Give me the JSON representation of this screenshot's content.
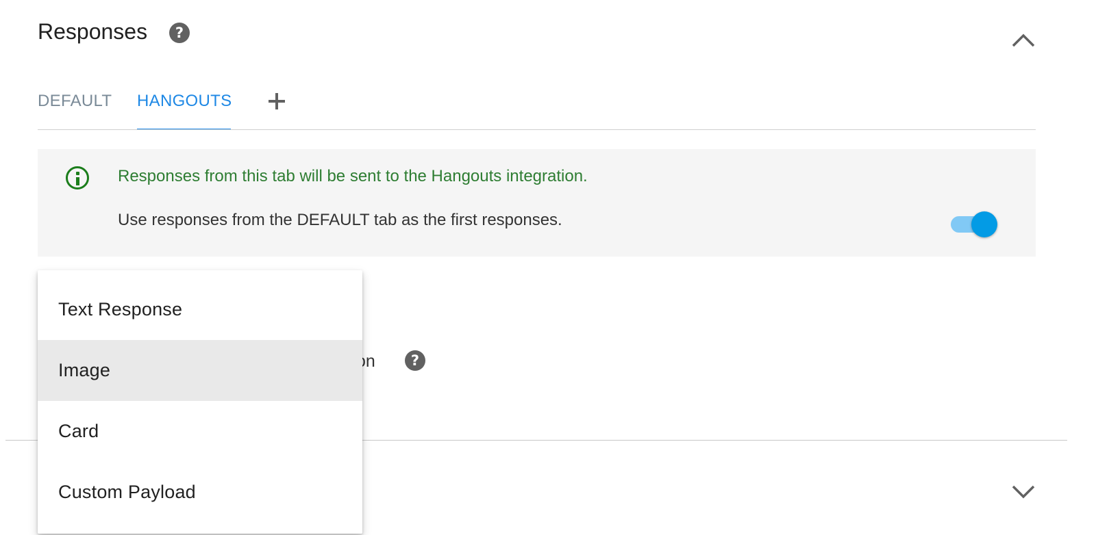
{
  "section": {
    "title": "Responses"
  },
  "tabs": {
    "items": [
      {
        "label": "DEFAULT"
      },
      {
        "label": "HANGOUTS"
      }
    ],
    "active": "HANGOUTS"
  },
  "info": {
    "message": "Responses from this tab will be sent to the Hangouts integration.",
    "toggle_label": "Use responses from the DEFAULT tab as the first responses.",
    "toggle_on": true
  },
  "background": {
    "partial_text": "on"
  },
  "menu": {
    "items": [
      {
        "label": "Text Response"
      },
      {
        "label": "Image"
      },
      {
        "label": "Card"
      },
      {
        "label": "Custom Payload"
      }
    ],
    "highlighted": "Image"
  },
  "colors": {
    "accent": "#1e88e5",
    "info_green": "#2e7d32",
    "toggle_on": "#039be5",
    "menu_highlight": "#e9e9e9"
  },
  "icons": {
    "section_help": "help-circle-icon",
    "collapse": "chevron-up-icon",
    "expand": "chevron-down-icon",
    "add_tab": "plus-icon",
    "info": "info-outline-icon",
    "field_help": "help-circle-icon"
  }
}
